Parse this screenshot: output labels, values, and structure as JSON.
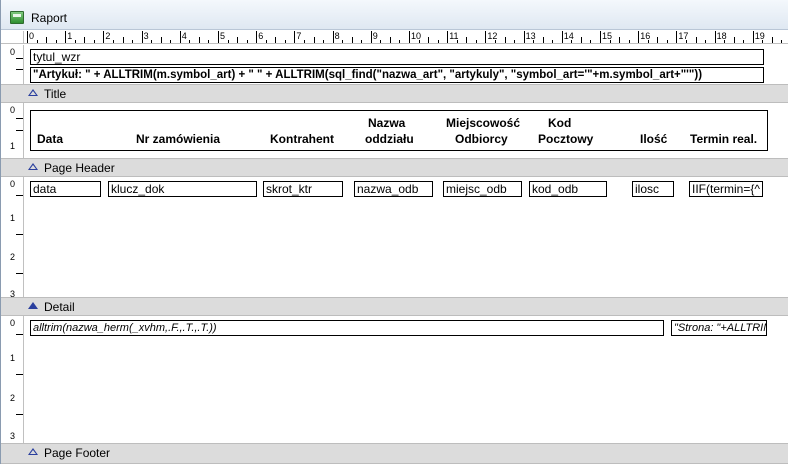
{
  "window": {
    "title": "Raport"
  },
  "ruler": {
    "labels": [
      "0",
      "1",
      "2",
      "3",
      "4",
      "5",
      "6",
      "7",
      "8",
      "9",
      "10",
      "11",
      "12",
      "13",
      "14",
      "15",
      "16",
      "17",
      "18",
      "19"
    ]
  },
  "bands": {
    "title": {
      "label": "Title",
      "fields": {
        "tytul": "tytul_wzr",
        "artykul": "\"Artykuł: \" + ALLTRIM(m.symbol_art) + \" \" + ALLTRIM(sql_find(\"nazwa_art\", \"artykuly\", \"symbol_art='\"+m.symbol_art+\"'\"))"
      }
    },
    "page_header": {
      "label": "Page Header",
      "columns": {
        "data": "Data",
        "nr_zam": "Nr zamówienia",
        "kontrahent": "Kontrahent",
        "nazwa_line1": "Nazwa",
        "nazwa_line2": "oddziału",
        "miejsc_line1": "Miejscowość",
        "miejsc_line2": "Odbiorcy",
        "kod_line1": "Kod",
        "kod_line2": "Pocztowy",
        "ilosc": "Ilość",
        "termin": "Termin real."
      }
    },
    "detail": {
      "label": "Detail",
      "fields": {
        "data": "data",
        "klucz": "klucz_dok",
        "skrot": "skrot_ktr",
        "nazwa_odb": "nazwa_odb",
        "miejsc_odb": "miejsc_odb",
        "kod_odb": "kod_odb",
        "ilosc": "ilosc",
        "termin": "IIF(termin={^"
      }
    },
    "page_footer": {
      "label": "Page Footer",
      "fields": {
        "nazwa_herm": "alltrim(nazwa_herm(_xvhm,.F.,.T.,.T.))",
        "strona": "\"Strona: \"+ALLTRIM"
      }
    }
  },
  "colors": {
    "section_bar": "#dcdcdc",
    "arrow": "#2a3f9e"
  }
}
